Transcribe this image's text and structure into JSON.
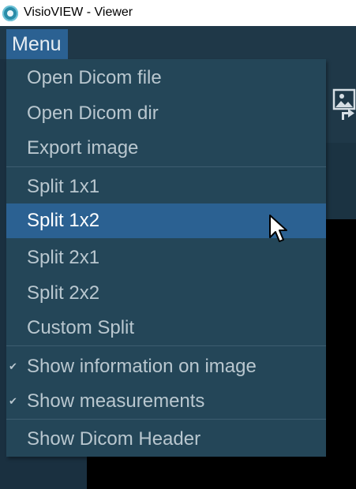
{
  "window": {
    "title": "VisioVIEW - Viewer"
  },
  "menubar": {
    "menu_label": "Menu"
  },
  "menu": {
    "items": [
      {
        "label": "Open Dicom file"
      },
      {
        "label": "Open Dicom dir"
      },
      {
        "label": "Export image"
      },
      {
        "label": "Split 1x1"
      },
      {
        "label": "Split 1x2",
        "highlighted": true
      },
      {
        "label": "Split 2x1"
      },
      {
        "label": "Split 2x2"
      },
      {
        "label": "Custom Split"
      },
      {
        "label": "Show information on image",
        "checked": true
      },
      {
        "label": "Show measurements",
        "checked": true
      },
      {
        "label": "Show Dicom Header"
      }
    ]
  },
  "colors": {
    "menu_background": "#244658",
    "highlight": "#2b6192",
    "menubar": "#1f3848",
    "text": "#b9c7cf"
  },
  "icons": {
    "app": "visioview-app-icon",
    "export": "image-export-icon",
    "check": "checkmark-icon",
    "cursor": "mouse-pointer-icon"
  }
}
